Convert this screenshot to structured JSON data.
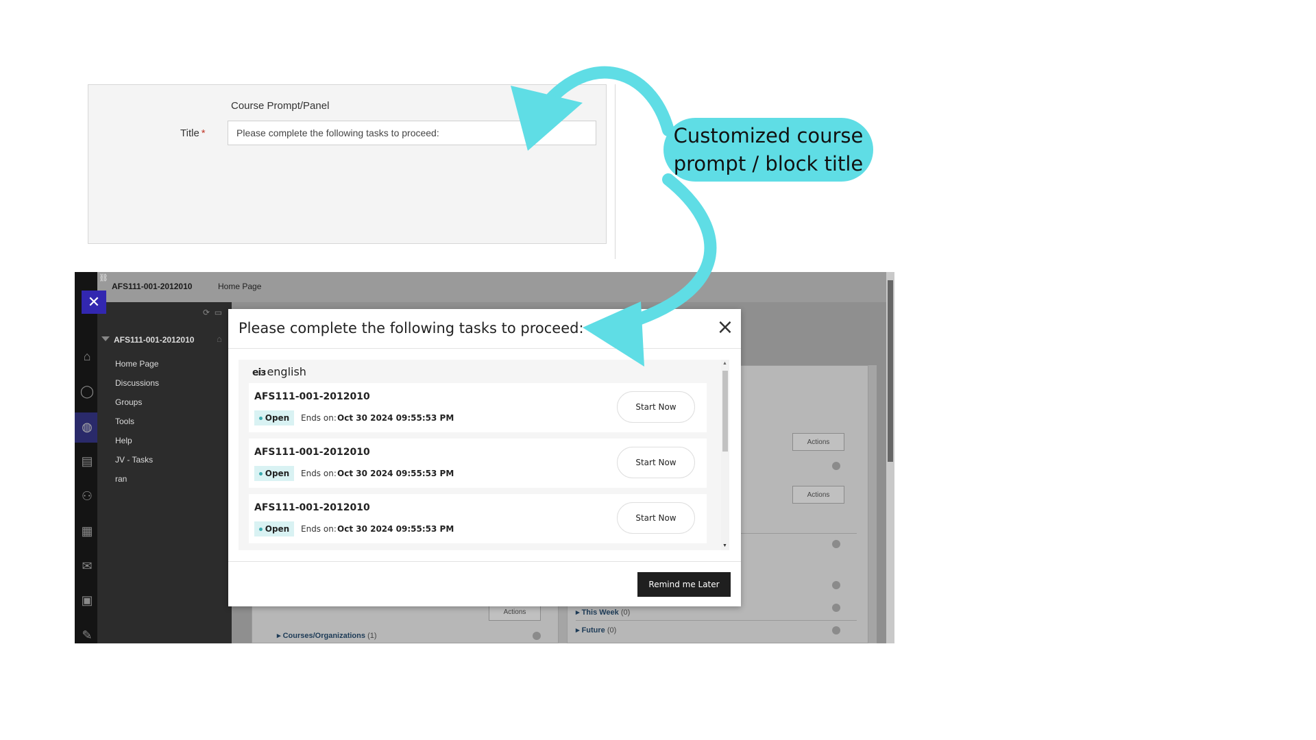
{
  "settings": {
    "heading": "Course Prompt/Panel",
    "title_label": "Title",
    "required_mark": "*",
    "title_value": "Please complete the following tasks to proceed:"
  },
  "callout": {
    "line1": "Customized course",
    "line2": "prompt / block title",
    "color": "#5fdde5"
  },
  "lms": {
    "course_code": "AFS111-001-2012010",
    "breadcrumb": "Home Page",
    "nav_course": "AFS111-001-2012010",
    "nav_items": [
      "Home Page",
      "Discussions",
      "Groups",
      "Tools",
      "Help",
      "JV - Tasks",
      "ran"
    ],
    "bg_actions_label": "Actions",
    "bg_links": [
      {
        "label": "Courses/Organizations",
        "count": "(1)"
      },
      {
        "label": "This Week",
        "count": "(0)"
      },
      {
        "label": "Future",
        "count": "(0)"
      }
    ],
    "accent": "#3227b0"
  },
  "modal": {
    "title": "Please complete the following tasks to proceed:",
    "close_symbol": "×",
    "brand_mark": "eiз",
    "brand_text": "english",
    "tasks": [
      {
        "name": "AFS111-001-2012010",
        "status": "Open",
        "ends_label": "Ends on:",
        "ends_value": "Oct 30 2024 09:55:53 PM",
        "action": "Start Now"
      },
      {
        "name": "AFS111-001-2012010",
        "status": "Open",
        "ends_label": "Ends on:",
        "ends_value": "Oct 30 2024 09:55:53 PM",
        "action": "Start Now"
      },
      {
        "name": "AFS111-001-2012010",
        "status": "Open",
        "ends_label": "Ends on:",
        "ends_value": "Oct 30 2024 09:55:53 PM",
        "action": "Start Now"
      }
    ],
    "remind_label": "Remind me Later",
    "badge_color": "#d9f2f3"
  },
  "icons": [
    "close-icon",
    "link-icon",
    "institution-icon",
    "user-icon",
    "globe-icon",
    "book-icon",
    "people-icon",
    "calendar-icon",
    "mail-icon",
    "grades-icon",
    "edit-icon",
    "refresh-icon",
    "folder-icon",
    "home-icon",
    "chevron-down-icon"
  ]
}
